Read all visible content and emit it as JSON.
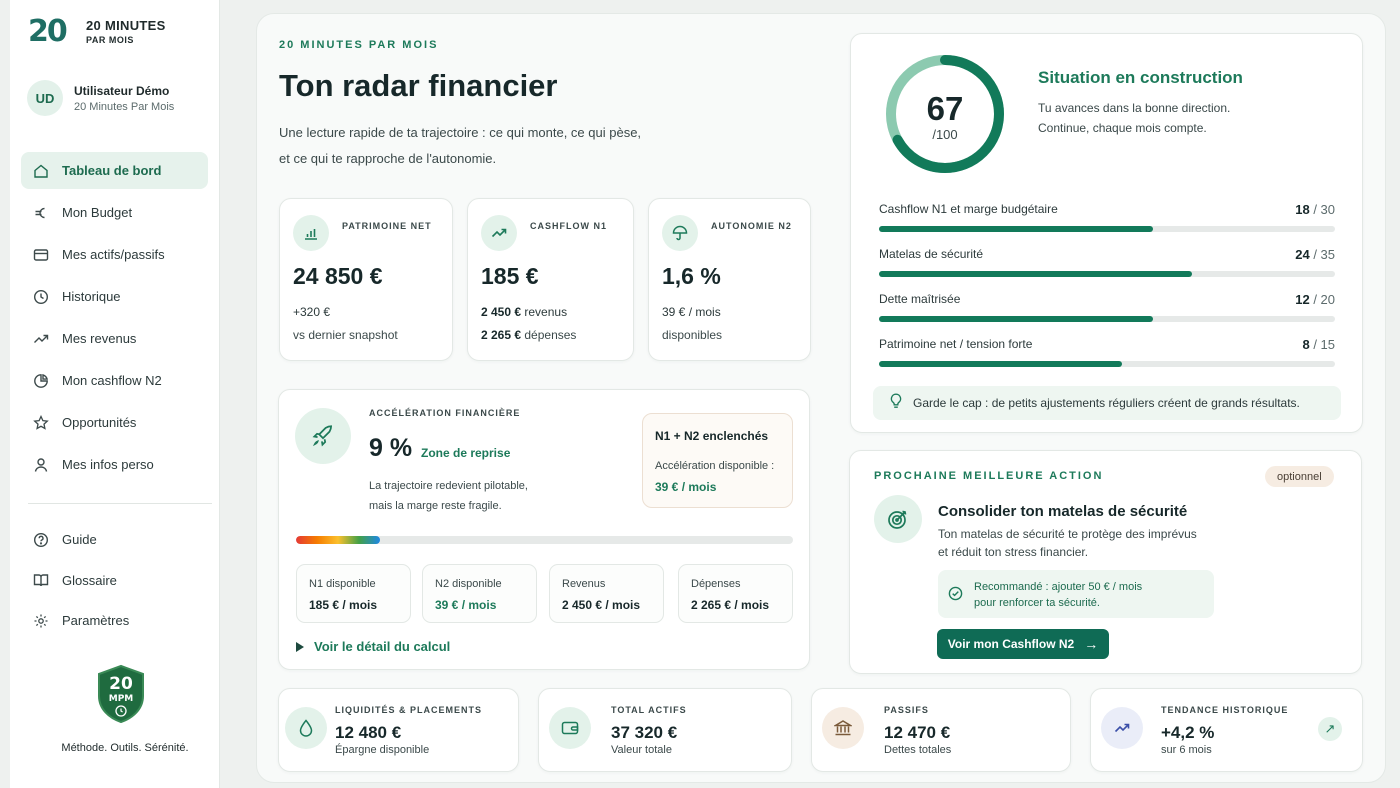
{
  "brand": {
    "logo_mark": "20",
    "title": "20 MINUTES",
    "subtitle": "PAR MOIS",
    "accent": "#1d7a5a",
    "badge_number": "20",
    "badge_text": "MPM",
    "tagline": "Méthode. Outils. Sérénité."
  },
  "user": {
    "initials": "UD",
    "name": "Utilisateur Démo",
    "subtitle": "20 Minutes Par Mois"
  },
  "nav": {
    "items": [
      {
        "label": "Tableau de bord",
        "icon": "home-icon",
        "active": true
      },
      {
        "label": "Mon Budget",
        "icon": "euro-icon"
      },
      {
        "label": "Mes actifs/passifs",
        "icon": "wallet-icon"
      },
      {
        "label": "Historique",
        "icon": "clock-icon"
      },
      {
        "label": "Mes revenus",
        "icon": "trend-up-icon"
      },
      {
        "label": "Mon cashflow N2",
        "icon": "pie-chart-icon"
      },
      {
        "label": "Opportunités",
        "icon": "star-icon"
      },
      {
        "label": "Mes infos perso",
        "icon": "user-icon"
      }
    ],
    "secondary": [
      {
        "label": "Guide",
        "icon": "help-icon"
      },
      {
        "label": "Glossaire",
        "icon": "book-icon"
      },
      {
        "label": "Paramètres",
        "icon": "settings-icon"
      }
    ]
  },
  "hero": {
    "eyebrow": "20 MINUTES PAR MOIS",
    "title": "Ton radar financier",
    "desc_line1": "Une lecture rapide de ta trajectoire : ce qui monte, ce qui pèse,",
    "desc_line2": "et ce qui te rapproche de l'autonomie."
  },
  "kpis": {
    "patrimoine": {
      "label": "PATRIMOINE NET",
      "value": "24 850 €",
      "line1": "+320 €",
      "line2": "vs dernier snapshot",
      "icon": "bar-chart-icon"
    },
    "cashflow": {
      "label": "CASHFLOW N1",
      "value": "185 €",
      "line1_num": "2 450 €",
      "line1_txt": " revenus",
      "line2_num": "2 265 €",
      "line2_txt": " dépenses",
      "icon": "trend-up-icon"
    },
    "autonomie": {
      "label": "AUTONOMIE N2",
      "value": "1,6 %",
      "line1": "39 € / mois",
      "line2": "disponibles",
      "icon": "umbrella-icon"
    }
  },
  "acceleration": {
    "label": "ACCÉLÉRATION FINANCIÈRE",
    "pct": "9 %",
    "zone": "Zone de reprise",
    "desc_line1": "La trajectoire redevient pilotable,",
    "desc_line2": "mais la marge reste fragile.",
    "side_title": "N1 + N2 enclenchés",
    "side_label": "Accélération disponible :",
    "side_value": "39 € / mois",
    "bar_fraction": 0.17,
    "mini": [
      {
        "label": "N1 disponible",
        "value": "185 € / mois",
        "green": false
      },
      {
        "label": "N2 disponible",
        "value": "39 € / mois",
        "green": true
      },
      {
        "label": "Revenus",
        "value": "2 450 € / mois",
        "green": false
      },
      {
        "label": "Dépenses",
        "value": "2 265 € / mois",
        "green": false
      }
    ],
    "link": "Voir le détail du calcul"
  },
  "score": {
    "value": "67",
    "denominator": "/100",
    "fraction": 0.67,
    "title": "Situation en construction",
    "desc_line1": "Tu avances dans la bonne direction.",
    "desc_line2": "Continue, chaque mois compte.",
    "rows": [
      {
        "label": "Cashflow N1 et marge budgétaire",
        "score": "18",
        "max": " / 30",
        "fraction": 0.6
      },
      {
        "label": "Matelas de sécurité",
        "score": "24",
        "max": " / 35",
        "fraction": 0.6857
      },
      {
        "label": "Dette maîtrisée",
        "score": "12",
        "max": " / 20",
        "fraction": 0.6
      },
      {
        "label": "Patrimoine net / tension forte",
        "score": "8",
        "max": " / 15",
        "fraction": 0.5333
      }
    ],
    "tip": "Garde le cap : de petits ajustements réguliers créent de grands résultats."
  },
  "next_action": {
    "eyebrow": "PROCHAINE MEILLEURE ACTION",
    "optional": "optionnel",
    "title": "Consolider ton matelas de sécurité",
    "desc_line1": "Ton matelas de sécurité te protège des imprévus",
    "desc_line2": "et réduit ton stress financier.",
    "reco_line1": "Recommandé : ajouter 50 € / mois",
    "reco_line2": "pour renforcer ta sécurité.",
    "button": "Voir mon Cashflow N2"
  },
  "bottom": {
    "liquidites": {
      "label": "LIQUIDITÉS & PLACEMENTS",
      "value": "12 480 €",
      "sub": "Épargne disponible",
      "icon": "drop-icon"
    },
    "actifs": {
      "label": "TOTAL ACTIFS",
      "value": "37 320 €",
      "sub": "Valeur totale",
      "icon": "wallet-icon"
    },
    "passifs": {
      "label": "PASSIFS",
      "value": "12 470 €",
      "sub": "Dettes totales",
      "icon": "bank-icon"
    },
    "tendance": {
      "label": "TENDANCE HISTORIQUE",
      "value": "+4,2 %",
      "sub": "sur 6 mois",
      "icon": "trend-up-icon"
    }
  }
}
